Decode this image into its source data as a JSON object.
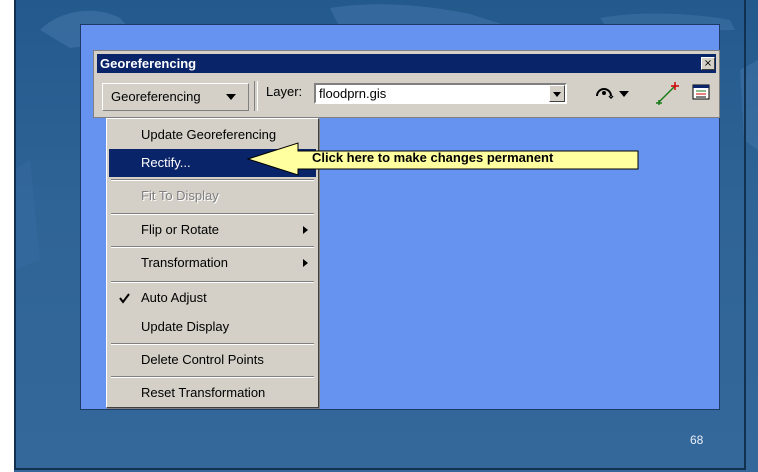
{
  "toolbar": {
    "title": "Georeferencing",
    "close_glyph": "×",
    "georef_menu_label": "Georeferencing",
    "layer_label": "Layer:",
    "layer_value": "floodprn.gis",
    "icons": [
      "rotate-icon",
      "dropdown-arrow-icon",
      "add-control-points-icon",
      "link-table-icon"
    ]
  },
  "menu": {
    "items": [
      {
        "label": "Update Georeferencing",
        "state": "normal"
      },
      {
        "label": "Rectify...",
        "state": "highlighted"
      },
      {
        "label": "Fit To Display",
        "state": "disabled"
      },
      {
        "label": "Flip or Rotate",
        "state": "submenu"
      },
      {
        "label": "Transformation",
        "state": "submenu"
      },
      {
        "label": "Auto Adjust",
        "state": "checked"
      },
      {
        "label": "Update Display",
        "state": "normal"
      },
      {
        "label": "Delete Control Points",
        "state": "normal"
      },
      {
        "label": "Reset Transformation",
        "state": "normal"
      }
    ]
  },
  "callout": {
    "text": "Click here to make changes permanent",
    "fill_color": "#ffffa0"
  },
  "slide": {
    "page_number": "68"
  },
  "colors": {
    "panel_blue": "#6593ef",
    "titlebar": "#0a246a",
    "window_gray": "#d4d0c8"
  }
}
